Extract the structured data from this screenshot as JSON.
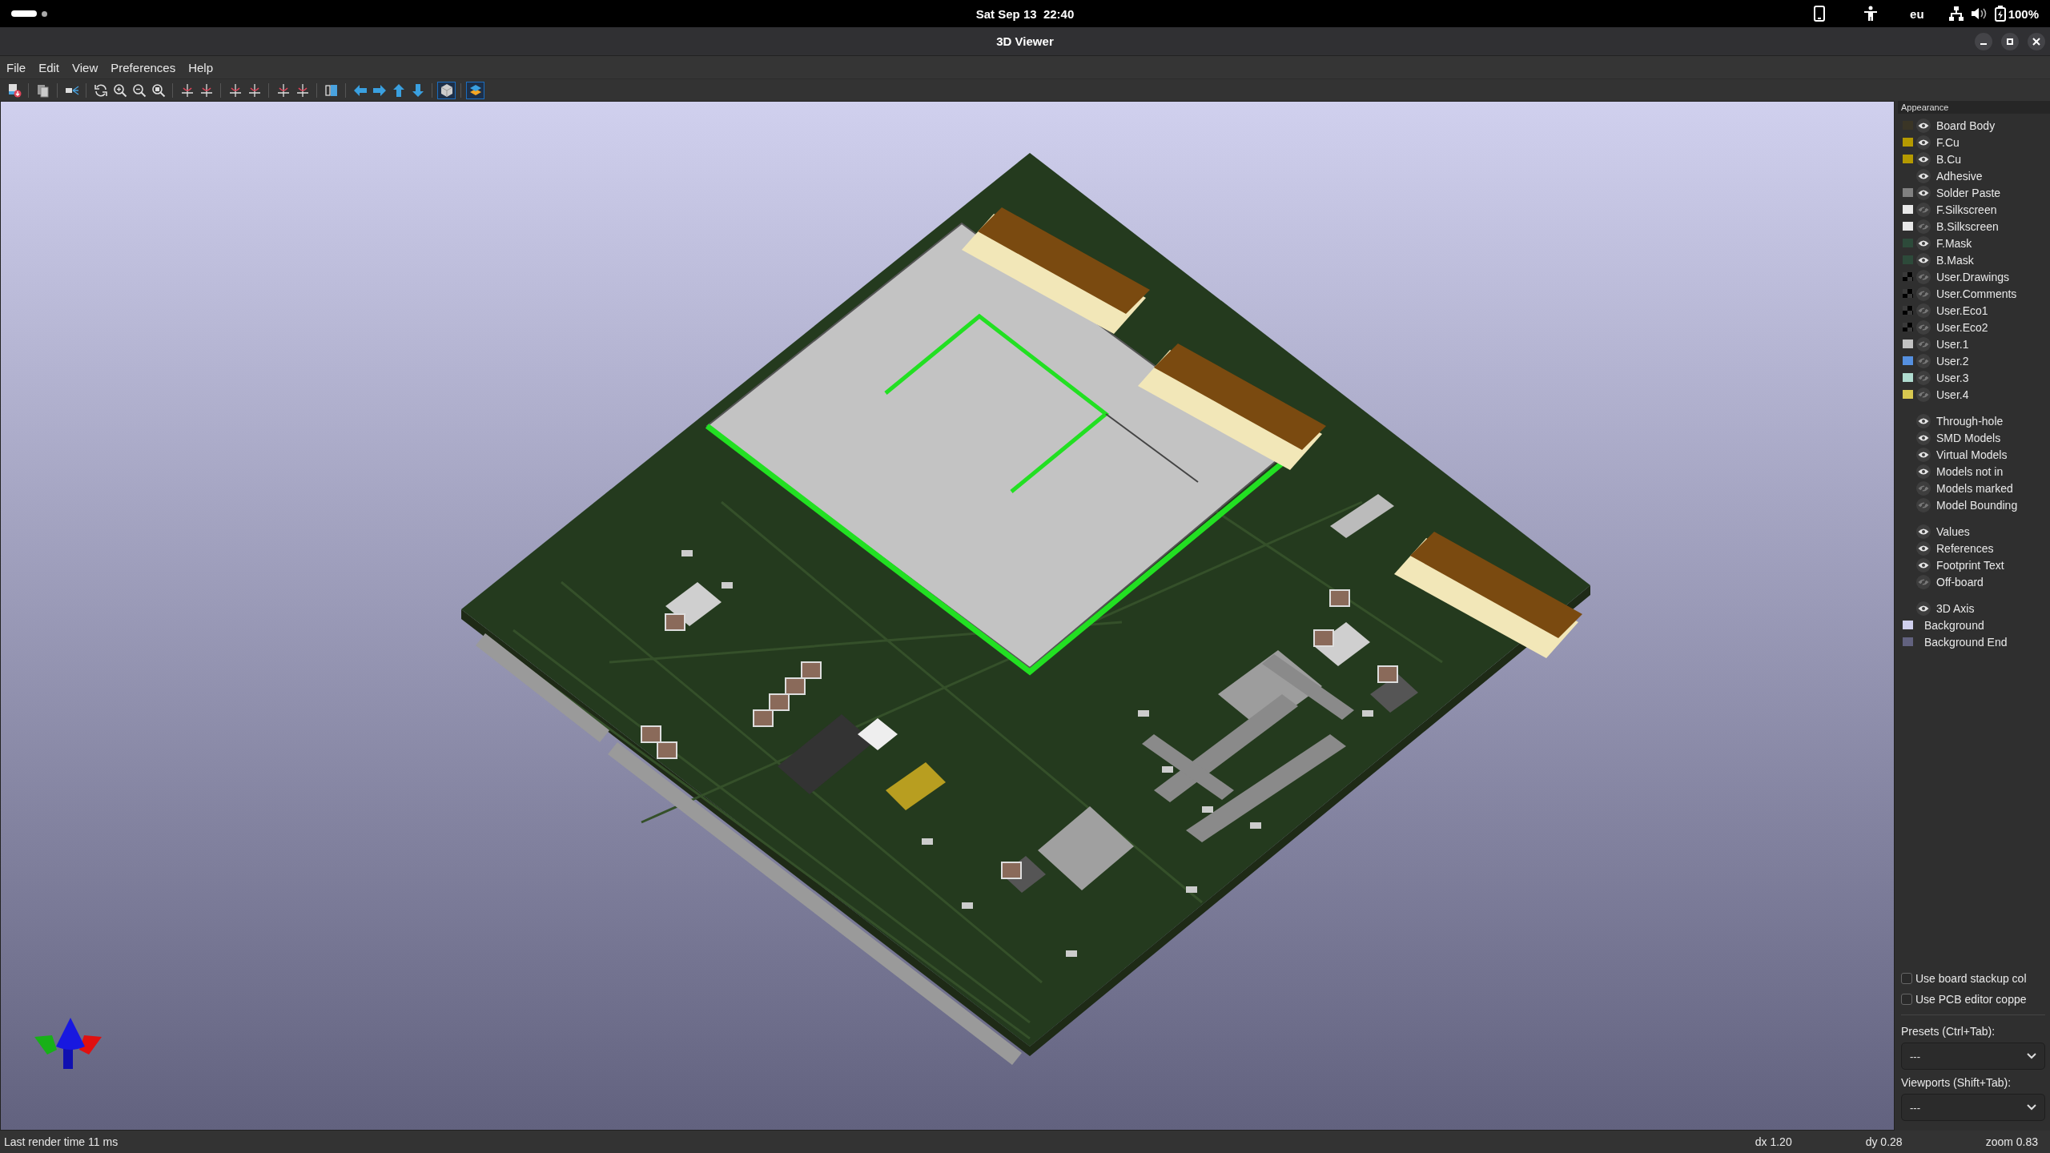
{
  "top_bar": {
    "clock": "Sat Sep 13  22:40",
    "keyboard_layout": "eu",
    "battery": "100%"
  },
  "window": {
    "title": "3D Viewer"
  },
  "menu": [
    "File",
    "Edit",
    "View",
    "Preferences",
    "Help"
  ],
  "toolbar": [
    {
      "kind": "export"
    },
    {
      "kind": "separator"
    },
    {
      "kind": "copy"
    },
    {
      "kind": "separator"
    },
    {
      "kind": "camera"
    },
    {
      "kind": "separator"
    },
    {
      "kind": "reload"
    },
    {
      "kind": "zoom-in"
    },
    {
      "kind": "zoom-out"
    },
    {
      "kind": "zoom-fit"
    },
    {
      "kind": "separator"
    },
    {
      "kind": "rotate-x"
    },
    {
      "kind": "rotate-x"
    },
    {
      "kind": "separator"
    },
    {
      "kind": "rotate-y"
    },
    {
      "kind": "rotate-y"
    },
    {
      "kind": "separator"
    },
    {
      "kind": "rotate-z"
    },
    {
      "kind": "rotate-z"
    },
    {
      "kind": "separator"
    },
    {
      "kind": "flip"
    },
    {
      "kind": "separator"
    },
    {
      "kind": "left"
    },
    {
      "kind": "right"
    },
    {
      "kind": "up"
    },
    {
      "kind": "down"
    },
    {
      "kind": "separator"
    },
    {
      "kind": "cube",
      "on": true
    },
    {
      "kind": "separator"
    },
    {
      "kind": "layers",
      "on": true
    }
  ],
  "panel": {
    "title": "Appearance",
    "sections": [
      {
        "items": [
          {
            "label": "Board Body",
            "color": "#3a3526",
            "visible": true
          },
          {
            "label": "F.Cu",
            "color": "#b59a00",
            "visible": true
          },
          {
            "label": "B.Cu",
            "color": "#b59a00",
            "visible": true
          },
          {
            "label": "Adhesive",
            "visible": true
          },
          {
            "label": "Solder Paste",
            "color": "#808080",
            "visible": true
          },
          {
            "label": "F.Silkscreen",
            "color": "#e8e8e8",
            "visible": false
          },
          {
            "label": "B.Silkscreen",
            "color": "#e8e8e8",
            "visible": false
          },
          {
            "label": "F.Mask",
            "color": "#2d4a3a",
            "visible": true
          },
          {
            "label": "B.Mask",
            "color": "#2d4a3a",
            "visible": true
          },
          {
            "label": "User.Drawings",
            "color": "#000000",
            "checkered": true,
            "visible": false
          },
          {
            "label": "User.Comments",
            "color": "#000000",
            "checkered": true,
            "visible": false
          },
          {
            "label": "User.Eco1",
            "color": "#000000",
            "checkered": true,
            "visible": false
          },
          {
            "label": "User.Eco2",
            "color": "#000000",
            "checkered": true,
            "visible": false
          },
          {
            "label": "User.1",
            "color": "#c2c2c2",
            "visible": false
          },
          {
            "label": "User.2",
            "color": "#5590e0",
            "visible": false
          },
          {
            "label": "User.3",
            "color": "#b0dcd0",
            "visible": false
          },
          {
            "label": "User.4",
            "color": "#d8c850",
            "visible": false
          }
        ]
      },
      {
        "items": [
          {
            "label": "Through-hole",
            "visible": true
          },
          {
            "label": "SMD Models",
            "visible": true
          },
          {
            "label": "Virtual Models",
            "visible": true
          },
          {
            "label": "Models not in",
            "visible": true
          },
          {
            "label": "Models marked",
            "visible": false
          },
          {
            "label": "Model Bounding",
            "visible": false
          }
        ]
      },
      {
        "items": [
          {
            "label": "Values",
            "visible": true
          },
          {
            "label": "References",
            "visible": true
          },
          {
            "label": "Footprint Text",
            "visible": true
          },
          {
            "label": "Off-board",
            "visible": false
          }
        ]
      },
      {
        "items": [
          {
            "label": "3D Axis",
            "visible": true
          },
          {
            "label": "Background",
            "color": "#d0d0ee"
          },
          {
            "label": "Background End",
            "color": "#62627f"
          }
        ]
      }
    ],
    "options": [
      {
        "label": "Use board stackup col",
        "checked": false
      },
      {
        "label": "Use PCB editor coppe",
        "checked": false
      }
    ],
    "presets": {
      "label": "Presets (Ctrl+Tab):",
      "value": "---"
    },
    "viewports": {
      "label": "Viewports (Shift+Tab):",
      "value": "---"
    }
  },
  "status_bar": {
    "message": "Last render time 11 ms",
    "dx": "dx 1.20",
    "dy": "dy 0.28",
    "zoom": "zoom 0.83"
  }
}
